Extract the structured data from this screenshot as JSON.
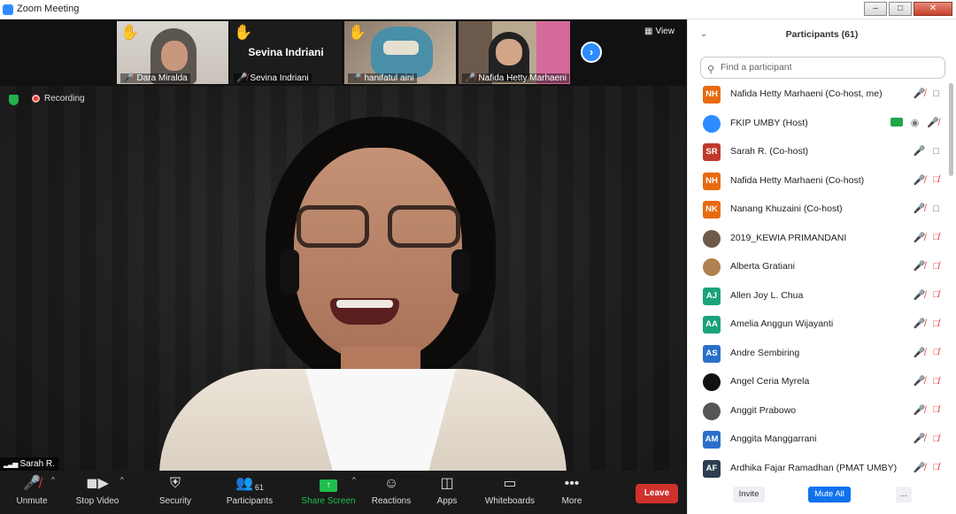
{
  "window": {
    "title": "Zoom Meeting"
  },
  "thumbnails": [
    {
      "name": "Dara Miralda",
      "hand": true
    },
    {
      "name": "Sevina Indriani",
      "hand": true,
      "display_name": "Sevina Indriani"
    },
    {
      "name": "hanifatul aini",
      "hand": true
    },
    {
      "name": "Nafida Hetty Marhaeni",
      "hand": false
    }
  ],
  "view_label": "View",
  "recording_label": "Recording",
  "speaker_name": "Sarah R.",
  "toolbar": {
    "unmute": "Unmute",
    "stop_video": "Stop Video",
    "security": "Security",
    "participants": "Participants",
    "participants_count": "61",
    "share_screen": "Share Screen",
    "reactions": "Reactions",
    "apps": "Apps",
    "whiteboards": "Whiteboards",
    "more": "More",
    "leave": "Leave"
  },
  "panel": {
    "title": "Participants (61)",
    "search_placeholder": "Find a participant",
    "invite": "Invite",
    "mute_all": "Mute All",
    "more": "..."
  },
  "participants": [
    {
      "initials": "NH",
      "name": "Nafida Hetty Marhaeni (Co-host, me)",
      "color": "#e86a10",
      "mic": "off",
      "cam": "on"
    },
    {
      "initials": "",
      "name": "FKIP UMBY (Host)",
      "color": "#2d8cff",
      "mic": "off",
      "cam": "host"
    },
    {
      "initials": "SR",
      "name": "Sarah R. (Co-host)",
      "color": "#c0392b",
      "mic": "on",
      "cam": "on"
    },
    {
      "initials": "NH",
      "name": "Nafida Hetty Marhaeni (Co-host)",
      "color": "#e86a10",
      "mic": "off",
      "cam": "off"
    },
    {
      "initials": "NK",
      "name": "Nanang Khuzaini (Co-host)",
      "color": "#e86a10",
      "mic": "off",
      "cam": "on"
    },
    {
      "initials": "",
      "name": "2019_KEWIA PRIMANDANI",
      "color": "#6d5a4a",
      "mic": "off",
      "cam": "off"
    },
    {
      "initials": "",
      "name": "Alberta Gratiani",
      "color": "#b08050",
      "mic": "off",
      "cam": "off"
    },
    {
      "initials": "AJ",
      "name": "Allen Joy L. Chua",
      "color": "#1aa37a",
      "mic": "off",
      "cam": "off"
    },
    {
      "initials": "AA",
      "name": "Amelia Anggun Wijayanti",
      "color": "#1aa37a",
      "mic": "off",
      "cam": "off"
    },
    {
      "initials": "AS",
      "name": "Andre Sembiring",
      "color": "#2a6fc9",
      "mic": "off",
      "cam": "off"
    },
    {
      "initials": "",
      "name": "Angel Ceria Myrela",
      "color": "#111111",
      "mic": "off",
      "cam": "off"
    },
    {
      "initials": "",
      "name": "Anggit Prabowo",
      "color": "#555555",
      "mic": "off",
      "cam": "off"
    },
    {
      "initials": "AM",
      "name": "Anggita Manggarrani",
      "color": "#2a6fc9",
      "mic": "off",
      "cam": "off"
    },
    {
      "initials": "AF",
      "name": "Ardhika Fajar Ramadhan (PMAT UMBY)",
      "color": "#2c3e50",
      "mic": "off",
      "cam": "off"
    }
  ]
}
